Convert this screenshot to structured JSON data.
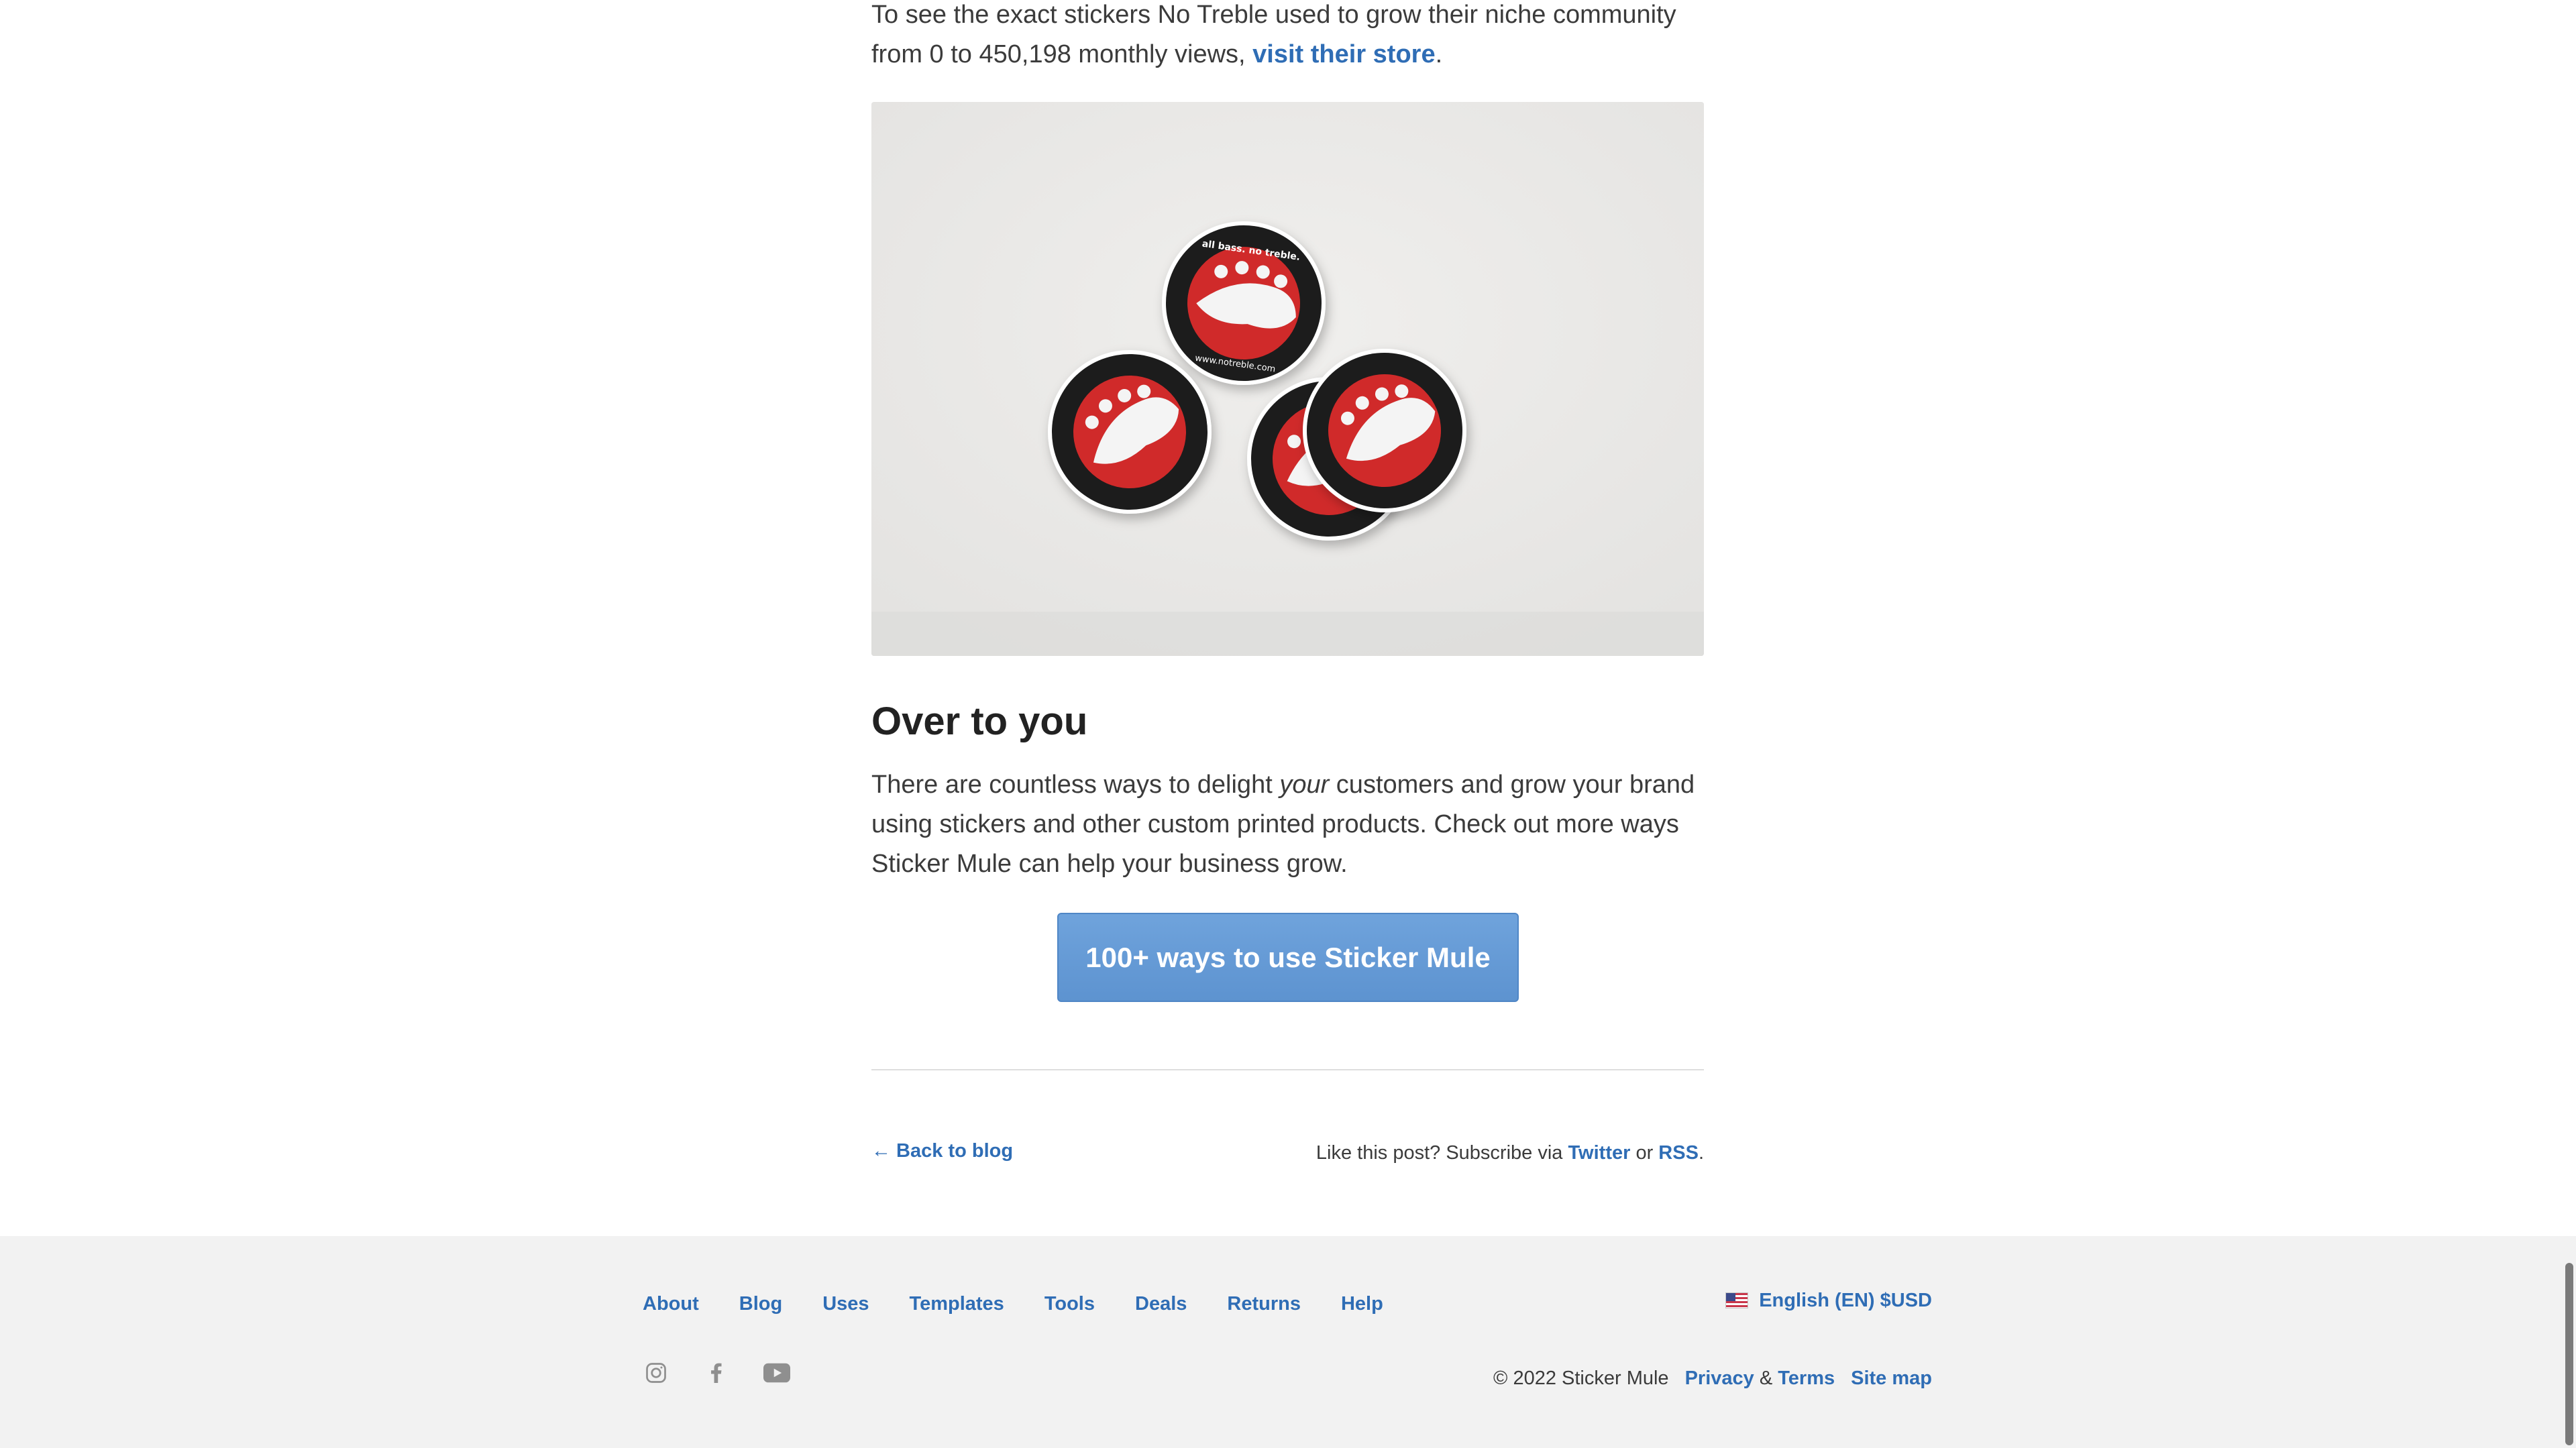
{
  "article": {
    "intro_text": "To see the exact stickers No Treble used to grow their niche community from 0 to 450,198 monthly views, ",
    "intro_link": "visit their store",
    "intro_end": ".",
    "hero_image_alt": "",
    "heading": "Over to you",
    "body_before": "There are countless ways to delight ",
    "body_emphasis": "your",
    "body_after": " customers and grow your brand using stickers and other custom printed products. Check out more ways Sticker Mule can help your business grow.",
    "cta_label": "100+ ways to use Sticker Mule",
    "back_link": "← Back to blog",
    "subscribe_prefix": "Like this post? Subscribe via ",
    "subscribe_twitter": "Twitter",
    "subscribe_or": " or ",
    "subscribe_rss": "RSS",
    "subscribe_end": "."
  },
  "sticker_text": {
    "top": "all bass. no treble.",
    "bottom": "www.notreble.com"
  },
  "footer": {
    "nav": [
      "About",
      "Blog",
      "Uses",
      "Templates",
      "Tools",
      "Deals",
      "Returns",
      "Help"
    ],
    "language": "English (EN) $USD",
    "social_icons": [
      "instagram-icon",
      "facebook-icon",
      "youtube-icon"
    ],
    "copyright": "© 2022 Sticker Mule",
    "privacy": "Privacy",
    "amp": " & ",
    "terms": "Terms",
    "sitemap": "Site map"
  },
  "colors": {
    "link": "#2f6db5",
    "cta": "#6fa3dc",
    "footer_bg": "#f2f2f2",
    "sticker_red": "#d02b2b"
  }
}
